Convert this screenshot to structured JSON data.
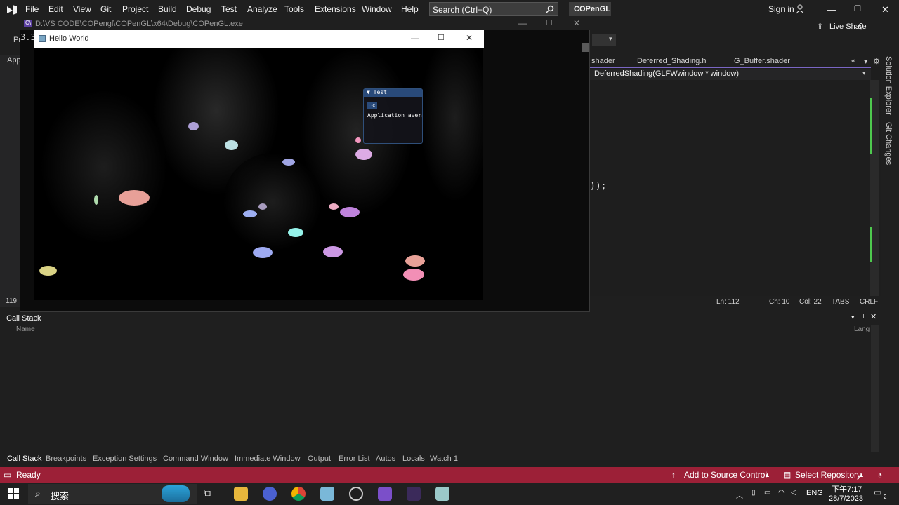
{
  "menubar": {
    "items": [
      "File",
      "Edit",
      "View",
      "Git",
      "Project",
      "Build",
      "Debug",
      "Test",
      "Analyze",
      "Tools",
      "Extensions",
      "Window",
      "Help"
    ],
    "search_placeholder": "Search (Ctrl+Q)",
    "project_name": "COPenGL",
    "sign_in": "Sign in",
    "live_share": "Live Share"
  },
  "console": {
    "title": "D:\\VS CODE\\COPengl\\COPenGL\\x64\\Debug\\COPenGL.exe",
    "text": "3.3"
  },
  "toolbar": {
    "fragment_pr": "Pr",
    "fragment_app": "App",
    "fragment_line": "119"
  },
  "hello_window": {
    "title": "Hello World"
  },
  "imgui": {
    "title": "▼ Test",
    "button": "~c",
    "text": "Application avera"
  },
  "editor": {
    "tabs": [
      "shader",
      "Deferred_Shading.h",
      "G_Buffer.shader"
    ],
    "function": "DeferredShading(GLFWwindow * window)",
    "code_fragment": "));",
    "status": {
      "ln": "Ln: 112",
      "ch": "Ch: 10",
      "col": "Col: 22",
      "tabs": "TABS",
      "crlf": "CRLF"
    },
    "side": [
      "Solution Explorer",
      "Git Changes"
    ]
  },
  "callstack": {
    "title": "Call Stack",
    "col_name": "Name",
    "col_lang": "Lang"
  },
  "bottom_tabs": [
    "Call Stack",
    "Breakpoints",
    "Exception Settings",
    "Command Window",
    "Immediate Window",
    "Output",
    "Error List",
    "Autos",
    "Locals",
    "Watch 1"
  ],
  "statusbar": {
    "ready": "Ready",
    "source_control": "Add to Source Control",
    "repository": "Select Repository"
  },
  "taskbar": {
    "search": "搜索",
    "lang": "ENG",
    "time": "下午7:17",
    "date": "28/7/2023",
    "notifications": "2"
  },
  "colors": {
    "statusbar": "#9c2037",
    "accent": "#7a66c4",
    "imgui_title": "#294a7a"
  },
  "scene_lights": [
    {
      "color": "#f4a9a0"
    },
    {
      "color": "#b5a7e0"
    },
    {
      "color": "#c6ecef"
    },
    {
      "color": "#a9aef0"
    },
    {
      "color": "#e8b3f0"
    },
    {
      "color": "#fbb6cf"
    },
    {
      "color": "#d7a0f0"
    },
    {
      "color": "#a7b3ff"
    },
    {
      "color": "#b0a3c8"
    },
    {
      "color": "#9dfff5"
    },
    {
      "color": "#a6b8ff"
    },
    {
      "color": "#c98ae8"
    },
    {
      "color": "#f4aaa0"
    },
    {
      "color": "#ff97c0"
    },
    {
      "color": "#e6de8c"
    },
    {
      "color": "#ff9ec8"
    },
    {
      "color": "#b8e7b6"
    }
  ]
}
